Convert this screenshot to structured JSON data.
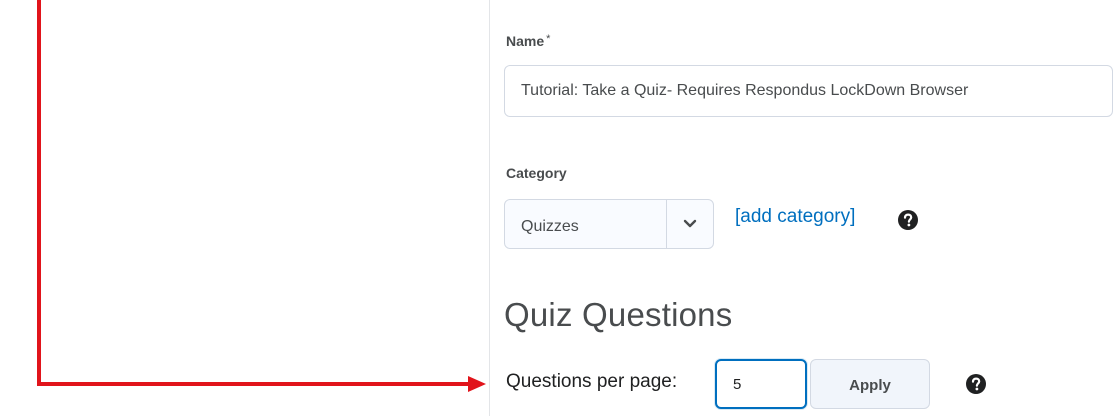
{
  "form": {
    "name_label": "Name",
    "name_required_marker": "*",
    "name_value": "Tutorial: Take a Quiz- Requires Respondus LockDown Browser",
    "category_label": "Category",
    "category_selected": "Quizzes",
    "add_category_link": "[add category]",
    "section_title": "Quiz Questions",
    "questions_per_page_label": "Questions per page:",
    "questions_per_page_value": "5",
    "apply_button": "Apply"
  },
  "icons": {
    "category_help": "help-circle-icon",
    "questions_help": "help-circle-icon",
    "select_dropdown": "chevron-down-icon"
  },
  "colors": {
    "annotation_arrow": "#e1141b",
    "link": "#006fbf",
    "focus_border": "#006fbf",
    "help_icon": "#202122"
  }
}
